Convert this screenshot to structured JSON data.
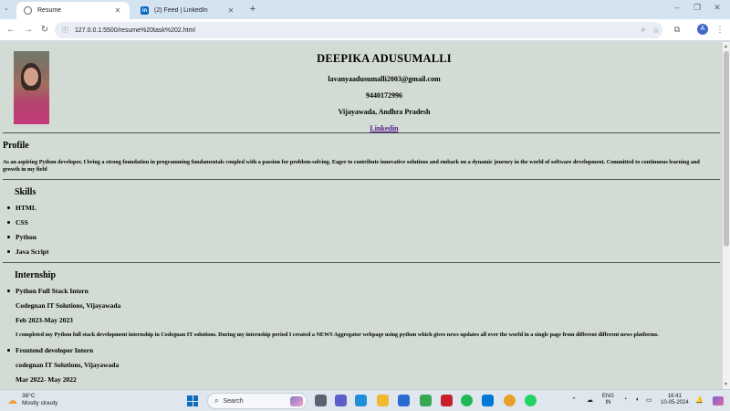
{
  "browser": {
    "tabs": [
      {
        "title": "Resume",
        "favicon": "globe-icon",
        "close": "✕"
      },
      {
        "title": "(2) Feed | LinkedIn",
        "favicon": "linkedin-icon",
        "close": "✕",
        "favicon_text": "in"
      }
    ],
    "new_tab": "+",
    "url": "127.0.0.1:5500/resume%20task%202.html",
    "profile_initial": "A"
  },
  "resume": {
    "name": "DEEPIKA ADUSUMALLI",
    "email": "lavanyaadusumalli2003@gmail.com",
    "phone": "9440172996",
    "location": "Vijayawada, Andhra Pradesh",
    "linkedin_label": "Linkedin",
    "profile_heading": "Profile",
    "profile_text": "As an aspiring Python developer, I bring a strong foundation in programming fundamentals coupled with a passion for problem-solving. Eager to contribute innovative solutions and embark on a dynamic journey in the world of software development. Committed to continuous learning and growth in my field",
    "skills_heading": "Skills",
    "skills": [
      "HTML",
      "CSS",
      "Python",
      "Java Script"
    ],
    "internship_heading": "Internship",
    "internships": [
      {
        "role": "Python Full Stack Intern",
        "company": "Codegnan IT Solutions, Vijayawada",
        "period": "Feb 2023-May 2023",
        "description": "I completed my Python full stack development internship in Codegnan IT solutions. During my internship period I created a NEWS Aggregator webpage using python which gives news updates all over the world in a single page from different different news platforms."
      },
      {
        "role": "Frontend developer Intern",
        "company": "codegnan IT Solutions, Vijayawada",
        "period": "Mar 2022- May 2022"
      }
    ]
  },
  "taskbar": {
    "temperature": "38°C",
    "weather": "Mostly cloudy",
    "search_label": "Search",
    "language_line1": "ENG",
    "language_line2": "IN",
    "time": "16:41",
    "date": "10-05-2024"
  },
  "colors": {
    "page_background": "#d3dbd5",
    "link": "#551a8b",
    "tabstrip": "#d3e3f0"
  }
}
